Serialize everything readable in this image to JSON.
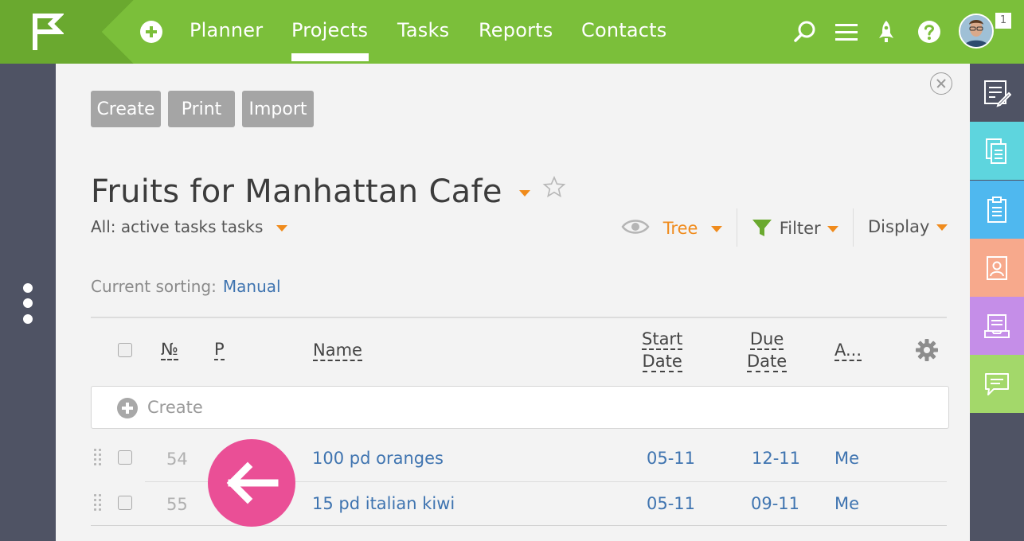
{
  "nav": {
    "items": [
      "Planner",
      "Projects",
      "Tasks",
      "Reports",
      "Contacts"
    ],
    "active": "Projects",
    "avatar_badge": "1"
  },
  "toolbar": {
    "create_label": "Create",
    "print_label": "Print",
    "import_label": "Import"
  },
  "project": {
    "title": "Fruits for Manhattan Cafe",
    "filter_text": "All: active tasks tasks"
  },
  "view": {
    "mode_label": "Tree",
    "filter_label": "Filter",
    "display_label": "Display"
  },
  "sorting": {
    "label": "Current sorting:",
    "value": "Manual"
  },
  "table": {
    "columns": {
      "number": "№",
      "priority": "P",
      "name": "Name",
      "start_line1": "Start",
      "start_line2": "Date",
      "due_line1": "Due",
      "due_line2": "Date",
      "assignee": "A..."
    },
    "create_placeholder": "Create",
    "rows": [
      {
        "number": "54",
        "name": "100 pd oranges",
        "start": "05-11",
        "due": "12-11",
        "assignee": "Me"
      },
      {
        "number": "55",
        "name": "15 pd italian kiwi",
        "start": "05-11",
        "due": "09-11",
        "assignee": "Me"
      }
    ]
  },
  "colors": {
    "topbar": "#7bbf3a",
    "accent_orange": "#f08b1c",
    "link_blue": "#3f74b0",
    "back_button": "#ea4f96",
    "tab_colors": [
      "#4f5364",
      "#5ed5de",
      "#4fb8ef",
      "#f7a98c",
      "#c58ee8",
      "#a3d86a"
    ]
  },
  "icons": [
    "flag-logo-icon",
    "plus-circle-icon",
    "search-icon",
    "menu-icon",
    "rocket-icon",
    "help-icon",
    "eye-icon",
    "funnel-icon",
    "gear-icon",
    "arrow-left-icon"
  ]
}
